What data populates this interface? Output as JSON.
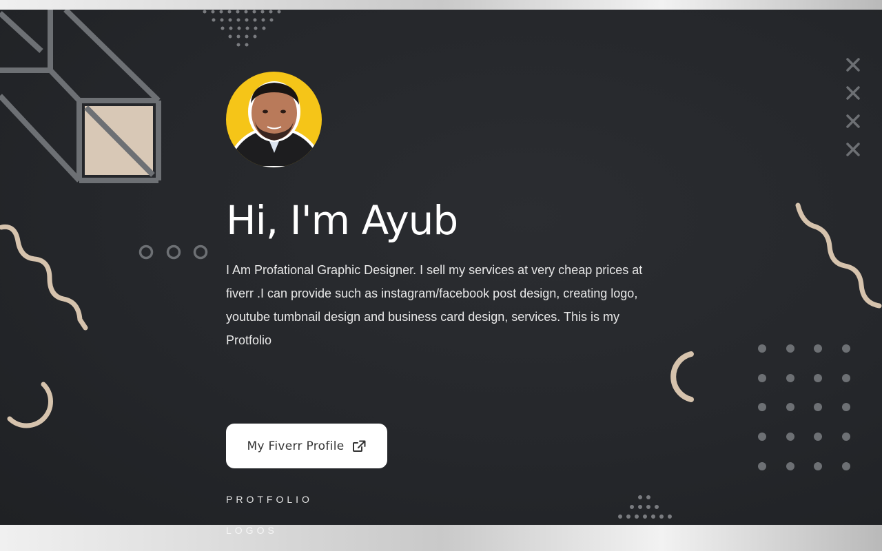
{
  "hero": {
    "title": "Hi, I'm Ayub",
    "bio": "I Am Profational Graphic Designer. I sell my services at very cheap prices at fiverr .I can provide such as instagram/facebook post design, creating logo, youtube tumbnail design and business card design, services. This is my Protfolio",
    "cta_label": "My Fiverr Profile",
    "cta_icon": "external-link-icon",
    "avatar_bg_color": "#f5c518"
  },
  "sections": {
    "portfolio_label": "PROTFOLIO",
    "logos_label": "LOGOS"
  },
  "colors": {
    "hero_bg": "#25272b",
    "accent_tan": "#d6c3ad",
    "decor_gray": "#6b6e72"
  }
}
